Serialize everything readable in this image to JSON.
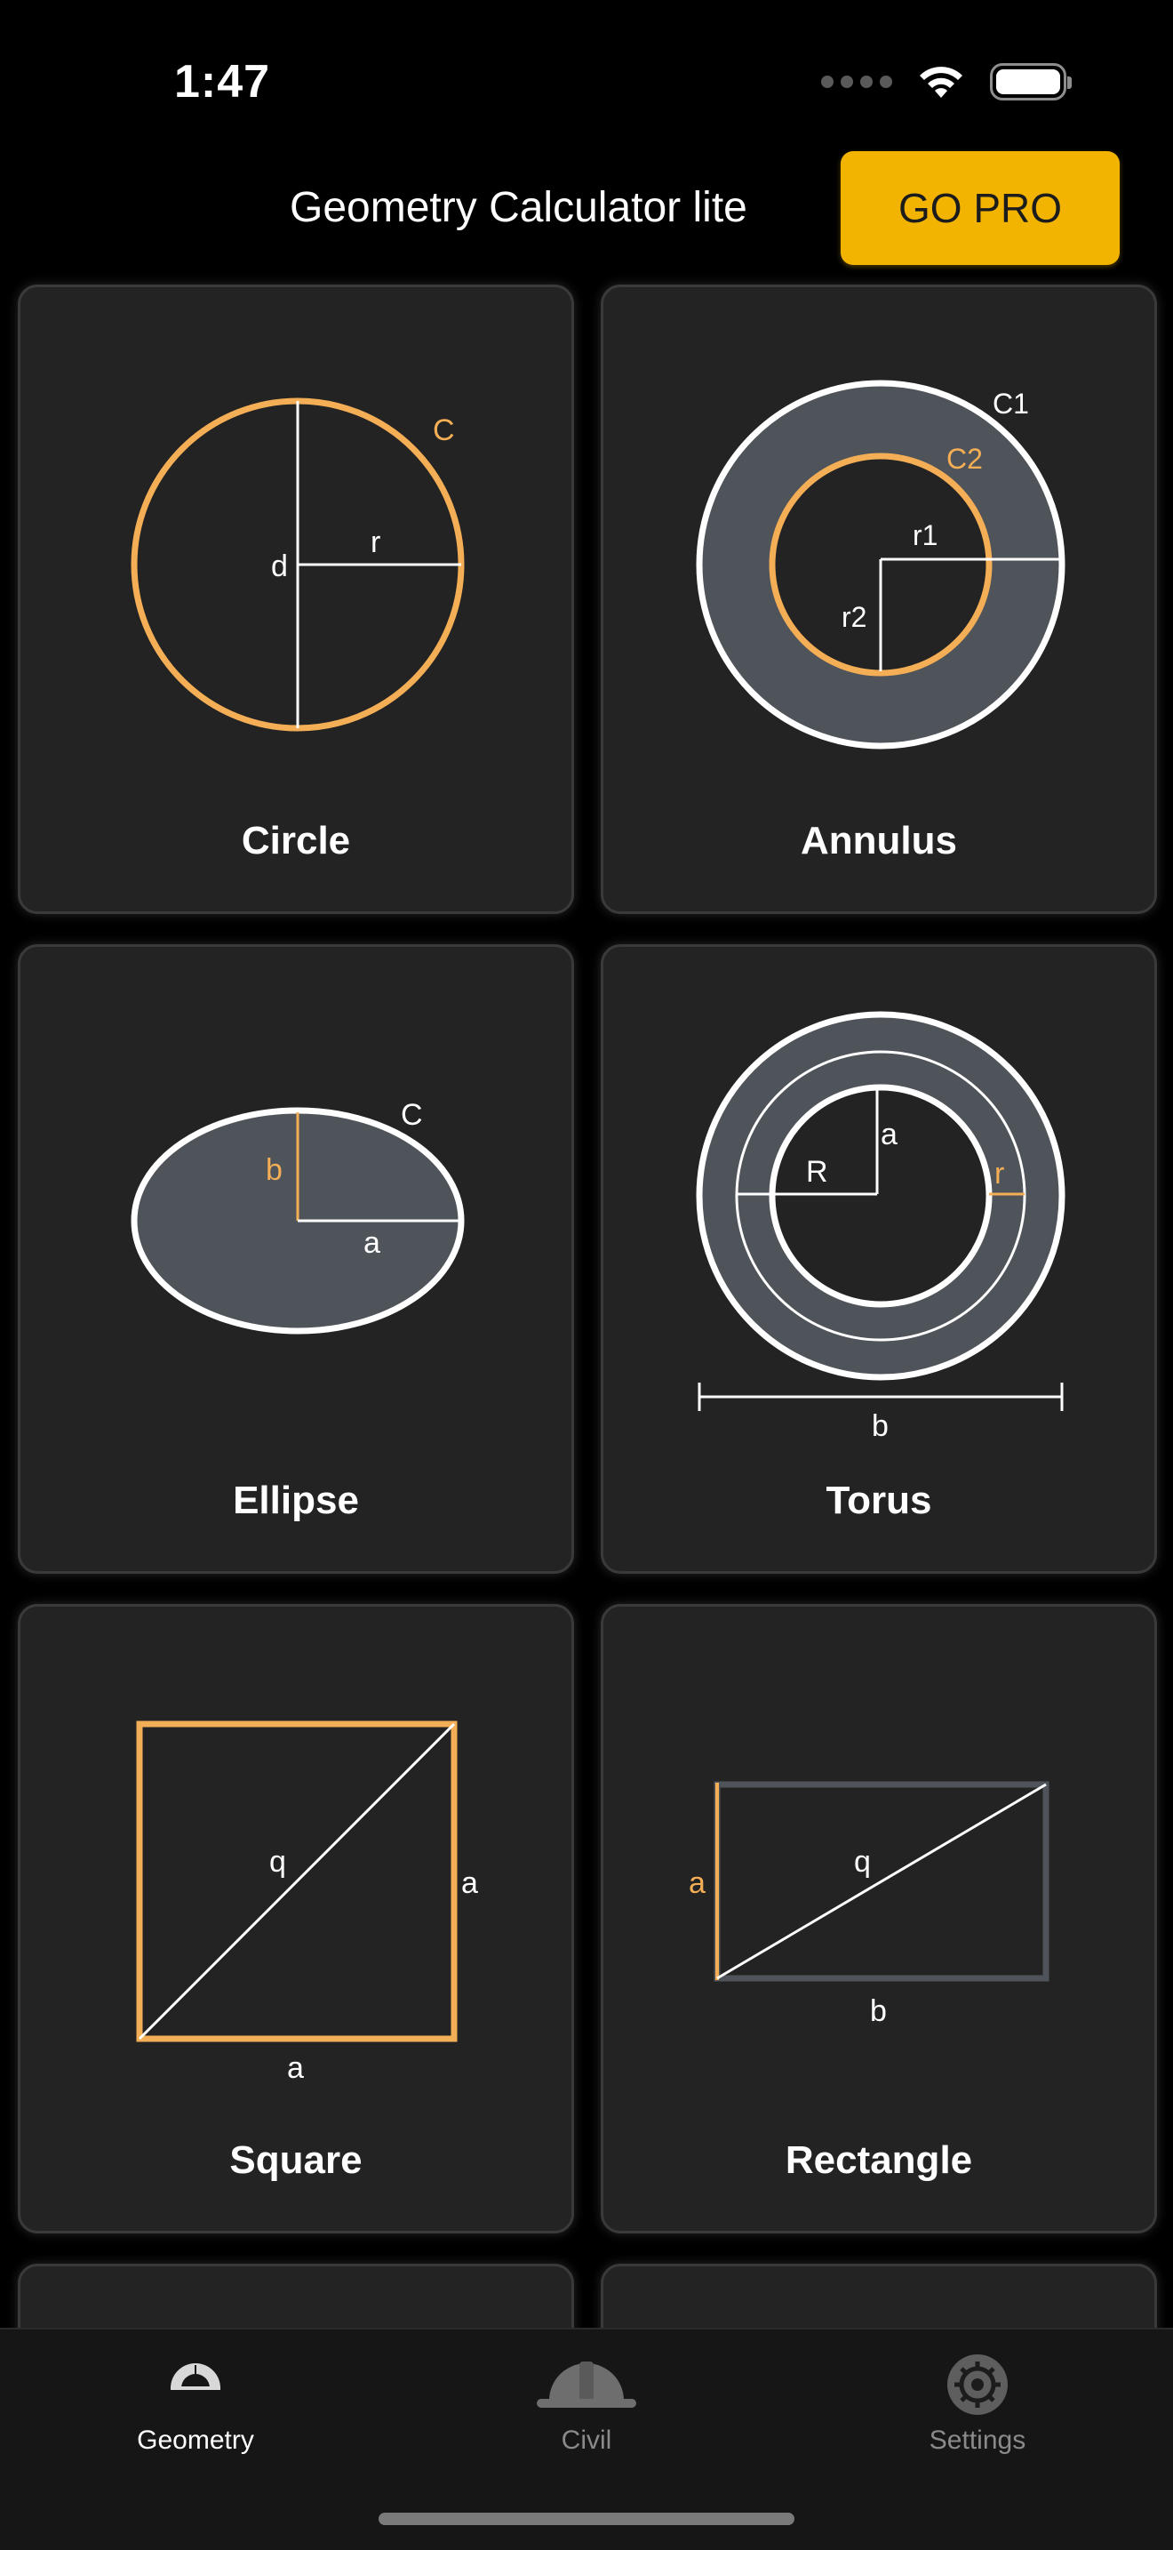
{
  "status": {
    "time": "1:47"
  },
  "header": {
    "title": "Geometry Calculator lite",
    "go_pro_label": "GO PRO"
  },
  "colors": {
    "accent": "#f2b400",
    "shape_orange": "#f4ae55",
    "card_bg": "#232323",
    "fill_gray": "#4f535a"
  },
  "cards": [
    {
      "label": "Circle",
      "labels": {
        "c": "C",
        "d": "d",
        "r": "r"
      }
    },
    {
      "label": "Annulus",
      "labels": {
        "c1": "C1",
        "c2": "C2",
        "r1": "r1",
        "r2": "r2"
      }
    },
    {
      "label": "Ellipse",
      "labels": {
        "c": "C",
        "b": "b",
        "a": "a"
      }
    },
    {
      "label": "Torus",
      "labels": {
        "a": "a",
        "R": "R",
        "r": "r",
        "b": "b"
      }
    },
    {
      "label": "Square",
      "labels": {
        "q": "q",
        "a_side": "a",
        "a_bottom": "a"
      }
    },
    {
      "label": "Rectangle",
      "labels": {
        "a": "a",
        "q": "q",
        "b": "b"
      }
    }
  ],
  "tabs": [
    {
      "label": "Geometry",
      "icon": "protractor-icon",
      "active": true
    },
    {
      "label": "Civil",
      "icon": "hard-hat-icon",
      "active": false
    },
    {
      "label": "Settings",
      "icon": "gear-icon",
      "active": false
    }
  ]
}
